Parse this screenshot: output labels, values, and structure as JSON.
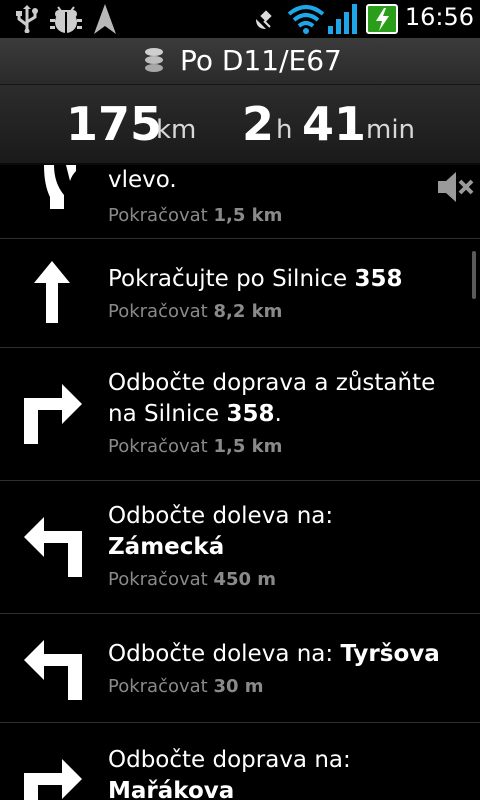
{
  "status_bar": {
    "time": "16:56",
    "icons": [
      "usb-icon",
      "debug-bug-icon",
      "navigation-arrow-icon",
      "satellite-icon",
      "wifi-icon",
      "signal-bars-icon",
      "battery-charging-icon"
    ]
  },
  "road": {
    "name": "Po D11/E67",
    "icon": "road-icon"
  },
  "summary": {
    "distance_value": "175",
    "distance_unit": "km",
    "hours_value": "2",
    "hours_unit": "h",
    "minutes_value": "41",
    "minutes_unit": "min"
  },
  "directions": [
    {
      "icon": "bear-left-arrow-icon",
      "text_plain": "vlevo.",
      "text_bold": "",
      "sub_label": "Pokračovat",
      "sub_value": "1,5 km"
    },
    {
      "icon": "straight-arrow-icon",
      "text_plain": "Pokračujte po Silnice ",
      "text_bold": "358",
      "sub_label": "Pokračovat",
      "sub_value": "8,2 km"
    },
    {
      "icon": "turn-right-arrow-icon",
      "text_plain": "Odbočte doprava a zůstaňte na Silnice ",
      "text_bold": "358",
      "text_after": ".",
      "sub_label": "Pokračovat",
      "sub_value": "1,5 km"
    },
    {
      "icon": "turn-left-arrow-icon",
      "text_plain": "Odbočte doleva na: ",
      "text_bold": "Zámecká",
      "sub_label": "Pokračovat",
      "sub_value": "450 m"
    },
    {
      "icon": "turn-left-arrow-icon",
      "text_plain": "Odbočte doleva na: ",
      "text_bold": "Tyršova",
      "sub_label": "Pokračovat",
      "sub_value": "30 m"
    },
    {
      "icon": "turn-right-arrow-icon",
      "text_plain": "Odbočte doprava na: ",
      "text_bold": "Mařákova",
      "sub_label": "",
      "sub_value": ""
    }
  ],
  "mute_icon": "mute-speaker-icon"
}
